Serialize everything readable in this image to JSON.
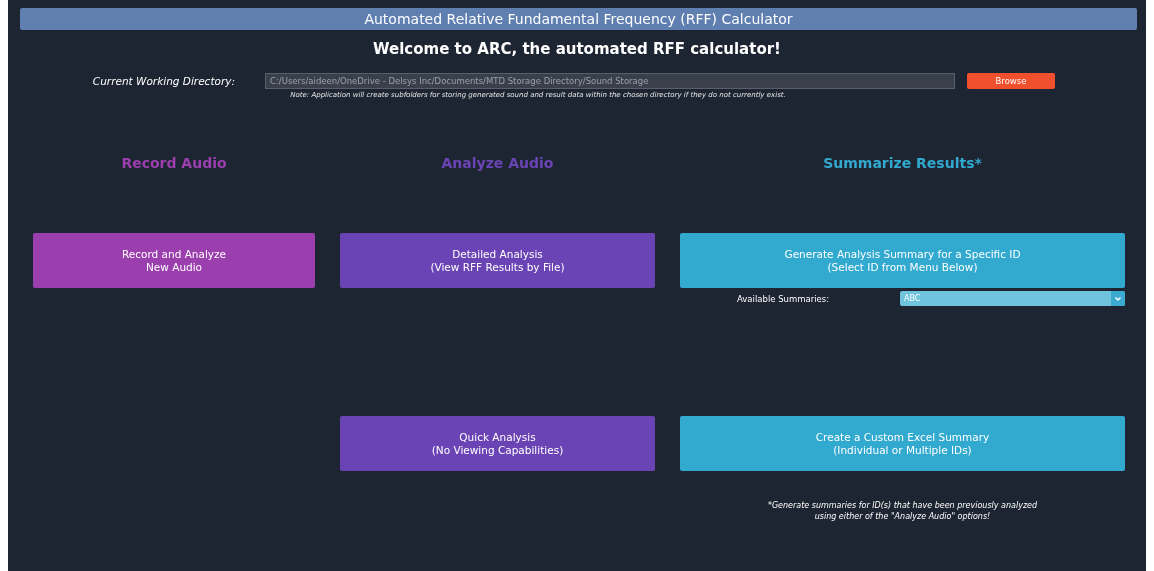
{
  "window": {
    "title": "Automated Relative Fundamental Frequency (RFF) Calculator"
  },
  "welcome": "Welcome to ARC, the automated RFF calculator!",
  "directory": {
    "label": "Current Working Directory:",
    "value": "C:/Users/aideen/OneDrive - Delsys Inc/Documents/MTD Storage Directory/Sound Storage",
    "button": "Browse",
    "note": "Note: Application will create subfolders for storing generated sound and result data within the chosen directory if they do not currently exist."
  },
  "columns": [
    {
      "heading": "Record Audio",
      "color": "#9b3fae",
      "buttons": [
        {
          "lines": [
            "Record and Analyze",
            "New Audio"
          ]
        }
      ]
    },
    {
      "heading": "Analyze Audio",
      "color": "#6a44b4",
      "buttons": [
        {
          "lines": [
            "Detailed Analysis",
            "(View RFF Results by File)"
          ]
        },
        {
          "lines": [
            "Quick Analysis",
            "(No Viewing Capabilities)"
          ]
        }
      ]
    },
    {
      "heading": "Summarize Results*",
      "color": "#32a9cf",
      "buttons": [
        {
          "lines": [
            "Generate Analysis Summary for a Specific ID",
            "(Select ID from Menu Below)"
          ]
        },
        {
          "lines": [
            "Create a Custom Excel Summary",
            "(Individual or Multiple IDs)"
          ]
        }
      ],
      "dropdown": {
        "label": "Available Summaries:",
        "value": "ABC"
      },
      "footnote": [
        "*Generate summaries for ID(s) that have been previously analyzed",
        "using either of the \"Analyze Audio\" options!"
      ]
    }
  ]
}
